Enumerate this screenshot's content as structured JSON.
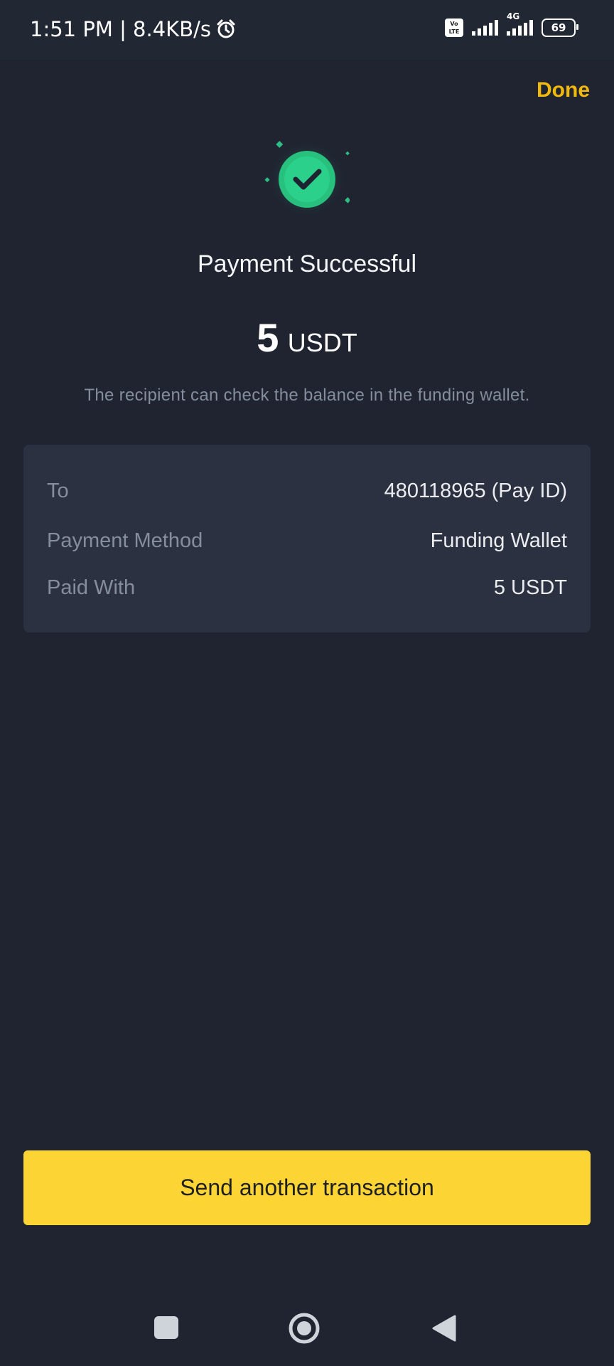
{
  "status_bar": {
    "time": "1:51 PM | 8.4KB/s",
    "alarm_icon": "alarm-clock-icon",
    "volte": "Vo\nLTE",
    "network": "4G",
    "battery": "69"
  },
  "header": {
    "done_label": "Done"
  },
  "result": {
    "icon": "check-circle-icon",
    "title": "Payment Successful",
    "amount": "5",
    "currency": "USDT",
    "subtitle": "The recipient can check the balance in the funding wallet."
  },
  "details": [
    {
      "label": "To",
      "value": "480118965 (Pay ID)"
    },
    {
      "label": "Payment Method",
      "value": "Funding Wallet"
    },
    {
      "label": "Paid With",
      "value": "5 USDT"
    }
  ],
  "actions": {
    "primary_label": "Send another transaction"
  },
  "nav": {
    "recents": "square-icon",
    "home": "circle-home-icon",
    "back": "triangle-back-icon"
  },
  "colors": {
    "background": "#1f2430",
    "card": "#2b3140",
    "accent": "#f0b90b",
    "button": "#fcd535",
    "success": "#2ebd85"
  }
}
